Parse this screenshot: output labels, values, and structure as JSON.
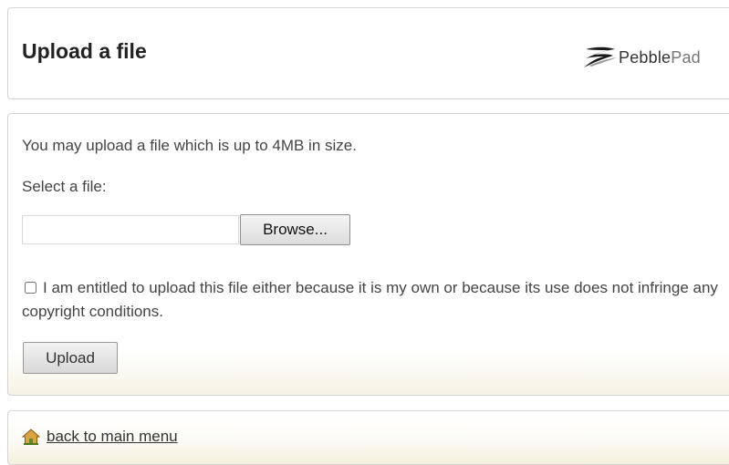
{
  "header": {
    "title": "Upload a file",
    "logo": {
      "icon": "pebblepad-swoosh-icon",
      "name_part1": "Pebble",
      "name_part2": "Pad"
    }
  },
  "form": {
    "info": "You may upload a file which is up to 4MB in size.",
    "select_label": "Select a file:",
    "file_input_value": "",
    "browse_label": "Browse...",
    "consent_text": "I am entitled to upload this file either because it is my own or because its use does not infringe any copyright conditions.",
    "consent_checked": false,
    "upload_label": "Upload"
  },
  "footer": {
    "back_icon": "home-icon",
    "back_label": "back to main menu"
  },
  "colors": {
    "text": "#444444",
    "title": "#222222",
    "border": "#d4d4d4",
    "footer_tint": "#f4f0dc",
    "home_icon": "#c28a2a"
  }
}
